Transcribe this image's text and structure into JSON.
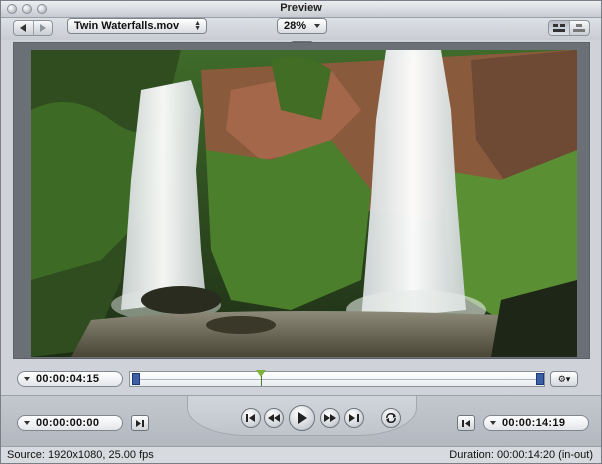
{
  "window": {
    "title": "Preview"
  },
  "toolbar": {
    "file_select": "Twin Waterfalls.mov",
    "zoom": "28%",
    "icons": [
      "back-arrow-icon",
      "forward-arrow-icon",
      "split-view-icon",
      "single-view-icon"
    ]
  },
  "scrubber": {
    "current_timecode": "00:00:04:15",
    "playhead_position": 0.31,
    "in_marker_position": 0.0,
    "out_marker_position": 1.0
  },
  "transport": {
    "in_timecode": "00:00:00:00",
    "out_timecode": "00:00:14:19",
    "icons": [
      "go-to-start-icon",
      "rewind-icon",
      "play-icon",
      "fast-forward-icon",
      "go-to-end-icon",
      "loop-icon"
    ]
  },
  "status": {
    "source": "Source: 1920x1080, 25.00 fps",
    "duration": "Duration: 00:00:14:20 (in-out)"
  },
  "colors": {
    "in_out_marker": "#3d5fa6",
    "playhead": "#7fb23a",
    "window_bg": "#cfd3d9"
  }
}
